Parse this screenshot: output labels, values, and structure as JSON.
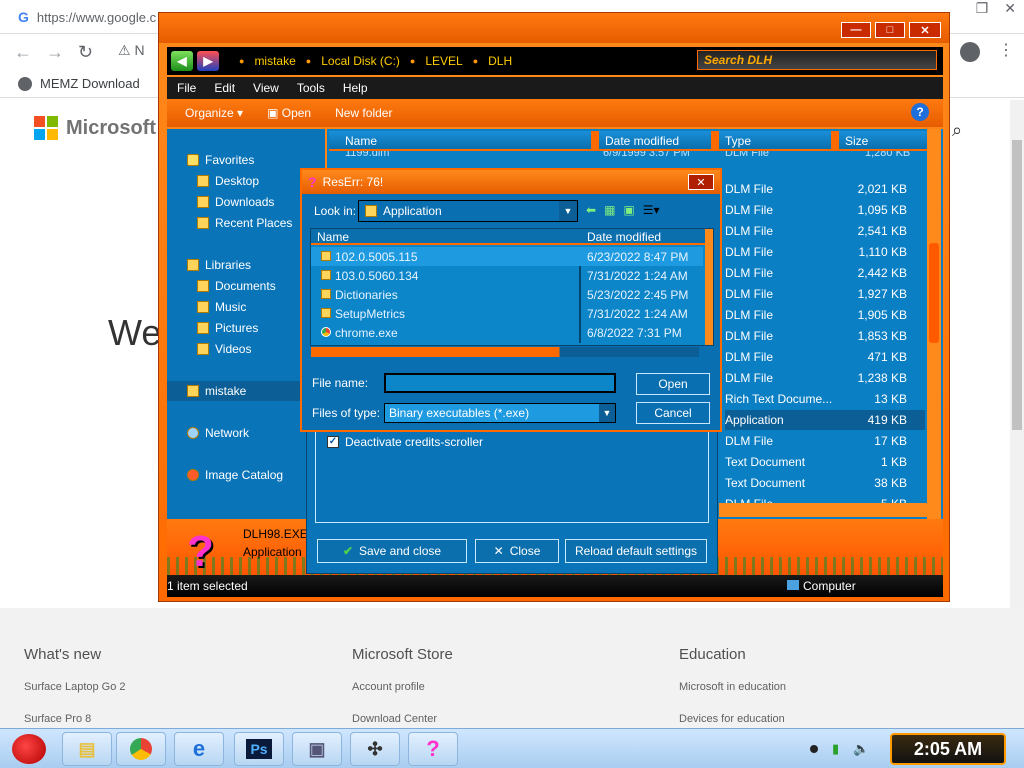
{
  "browser": {
    "url": "https://www.google.c",
    "address_fragment": "N",
    "bookmark": "MEMZ Download",
    "brand": "Microsoft",
    "hero_text": "We",
    "footer": [
      {
        "heading": "What's new",
        "links": [
          "Surface Laptop Go 2",
          "Surface Pro 8"
        ]
      },
      {
        "heading": "Microsoft Store",
        "links": [
          "Account profile",
          "Download Center"
        ]
      },
      {
        "heading": "Education",
        "links": [
          "Microsoft in education",
          "Devices for education"
        ]
      }
    ]
  },
  "explorer": {
    "window_controls": {
      "minimize": "—",
      "maximize": "□",
      "close": "✕"
    },
    "breadcrumbs": [
      "mistake",
      "Local Disk (C:)",
      "LEVEL",
      "DLH"
    ],
    "search_placeholder": "Search DLH",
    "menu": [
      "File",
      "Edit",
      "View",
      "Tools",
      "Help"
    ],
    "toolbar": {
      "organize": "Organize ▾",
      "open": "Open",
      "new_folder": "New folder",
      "help": "?"
    },
    "nav": {
      "favorites": "Favorites",
      "desktop": "Desktop",
      "downloads": "Downloads",
      "recent": "Recent Places",
      "libraries": "Libraries",
      "documents": "Documents",
      "music": "Music",
      "pictures": "Pictures",
      "videos": "Videos",
      "mistake": "mistake",
      "network": "Network",
      "image_catalog": "Image Catalog"
    },
    "columns": {
      "name": "Name",
      "date": "Date modified",
      "type": "Type",
      "size": "Size"
    },
    "partial_row": {
      "name": "1199.dlm",
      "date": "6/9/1999 3:57 PM",
      "type": "DLM File",
      "size": "1,280 KB"
    },
    "files": [
      {
        "type": "DLM File",
        "size": "2,021 KB"
      },
      {
        "type": "DLM File",
        "size": "1,095 KB"
      },
      {
        "type": "DLM File",
        "size": "2,541 KB"
      },
      {
        "type": "DLM File",
        "size": "1,110 KB"
      },
      {
        "type": "DLM File",
        "size": "2,442 KB"
      },
      {
        "type": "DLM File",
        "size": "1,927 KB"
      },
      {
        "type": "DLM File",
        "size": "1,905 KB"
      },
      {
        "type": "DLM File",
        "size": "1,853 KB"
      },
      {
        "type": "DLM File",
        "size": "471 KB"
      },
      {
        "type": "DLM File",
        "size": "1,238 KB"
      },
      {
        "type": "Rich Text Docume...",
        "size": "13 KB"
      },
      {
        "type": "Application",
        "size": "419 KB"
      },
      {
        "type": "DLM File",
        "size": "17 KB"
      },
      {
        "type": "Text Document",
        "size": "1 KB"
      },
      {
        "type": "Text Document",
        "size": "38 KB"
      },
      {
        "type": "DLM File",
        "size": "5 KB"
      }
    ],
    "selected_index": 11,
    "preview": {
      "name": "DLH98.EXE",
      "type": "Application"
    },
    "status": {
      "selection": "1 item selected",
      "location": "Computer"
    }
  },
  "customize": {
    "checkbox": "Deactivate credits-scroller",
    "save": "Save and close",
    "close": "Close",
    "reload": "Reload default settings"
  },
  "reserr": {
    "title": "ResErr: 76!",
    "close": "✕",
    "look_in_label": "Look in:",
    "look_in_value": "Application",
    "columns": {
      "name": "Name",
      "date": "Date modified"
    },
    "rows": [
      {
        "name": "102.0.5005.115",
        "date": "6/23/2022 8:47 PM",
        "icon": "folder-icon"
      },
      {
        "name": "103.0.5060.134",
        "date": "7/31/2022 1:24 AM",
        "icon": "folder-icon"
      },
      {
        "name": "Dictionaries",
        "date": "5/23/2022 2:45 PM",
        "icon": "folder-icon"
      },
      {
        "name": "SetupMetrics",
        "date": "7/31/2022 1:24 AM",
        "icon": "folder-icon"
      },
      {
        "name": "chrome.exe",
        "date": "6/8/2022 7:31 PM",
        "icon": "chrome-icon"
      }
    ],
    "file_name_label": "File name:",
    "file_name_value": "",
    "file_type_label": "Files of type:",
    "file_type_value": "Binary executables (*.exe)",
    "open": "Open",
    "cancel": "Cancel"
  },
  "taskbar": {
    "apps": [
      "angry-birds-icon",
      "folder-icon",
      "chrome-icon",
      "internet-explorer-icon",
      "photoshop-icon",
      "media-icon",
      "tools-icon",
      "question-icon"
    ],
    "ps_label": "Ps",
    "clock": "2:05 AM"
  },
  "colors": {
    "accent": "#ff6a00",
    "panel": "#0a74b8",
    "selection": "#1e9ae0"
  }
}
